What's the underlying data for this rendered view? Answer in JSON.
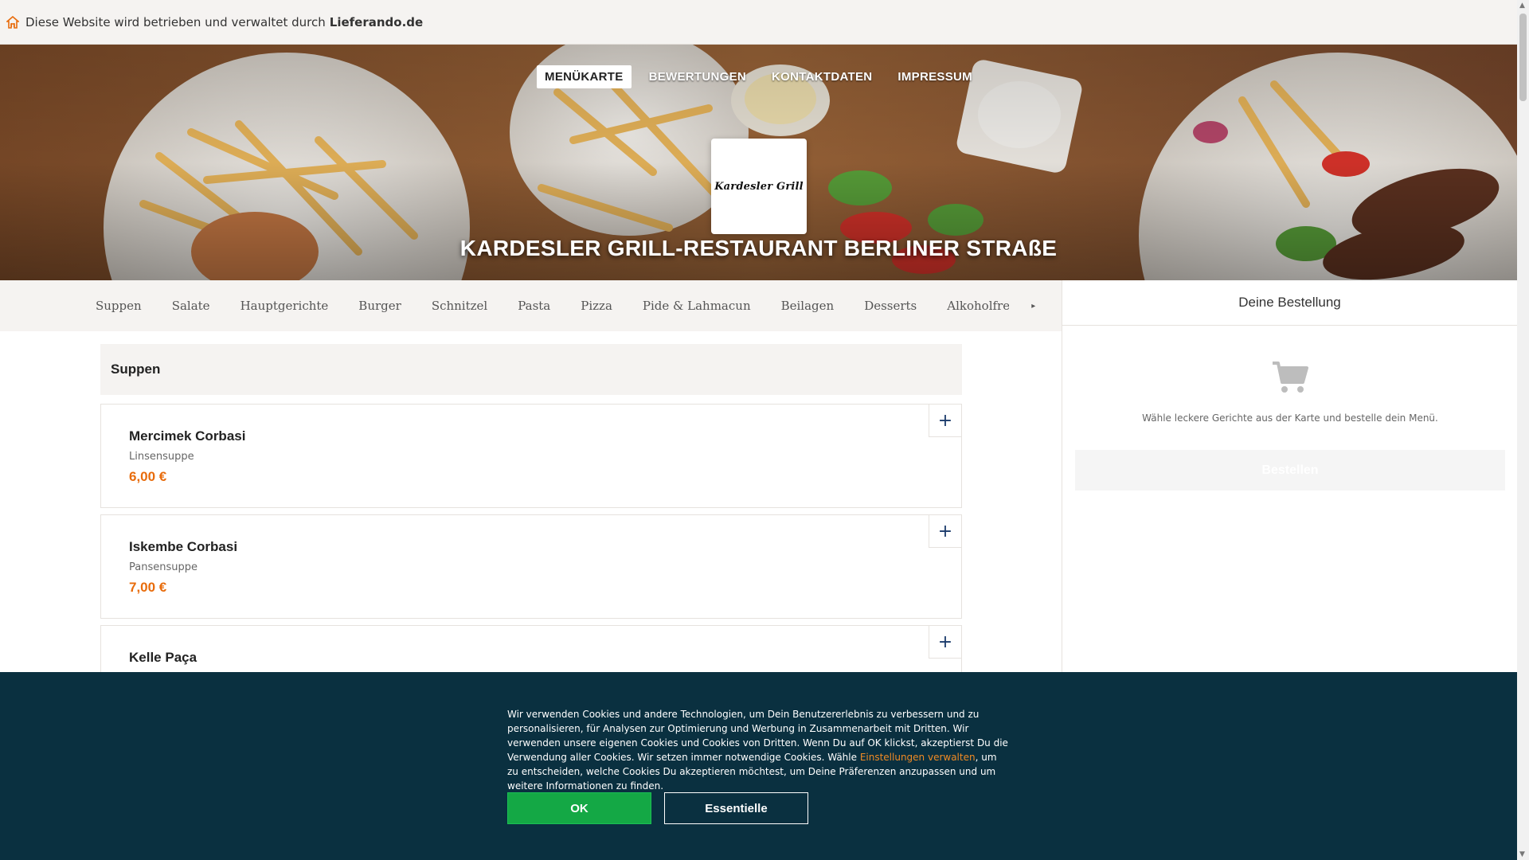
{
  "notice": {
    "text": "Diese Website wird betrieben und verwaltet durch",
    "brand": "Lieferando.de",
    "icon": "house-icon",
    "icon_color": "#e86c0c"
  },
  "top_nav": {
    "items": [
      "MENÜKARTE",
      "BEWERTUNGEN",
      "KONTAKTDATEN",
      "IMPRESSUM"
    ],
    "active_index": 0
  },
  "logo": {
    "text": "Kardesler Grill"
  },
  "restaurant": {
    "title": "KARDESLER GRILL-RESTAURANT BERLINER STRAßE"
  },
  "categories": {
    "items": [
      "Suppen",
      "Salate",
      "Hauptgerichte",
      "Burger",
      "Schnitzel",
      "Pasta",
      "Pizza",
      "Pide & Lahmacun",
      "Beilagen",
      "Desserts",
      "Alkoholfreie"
    ],
    "more_icon": "chevron-right-icon"
  },
  "section": {
    "title": "Suppen"
  },
  "menu_items": [
    {
      "name": "Mercimek Corbasi",
      "description": "Linsensuppe",
      "price": "6,00 €"
    },
    {
      "name": "Iskembe Corbasi",
      "description": "Pansensuppe",
      "price": "7,00 €"
    },
    {
      "name": "Kelle Paça",
      "description": "",
      "price": ""
    }
  ],
  "add_label": "+",
  "cart": {
    "title": "Deine Bestellung",
    "icon": "shopping-cart-icon",
    "empty_text": "Wähle leckere Gerichte aus der Karte und bestelle dein Menü.",
    "order_button": "Bestellen"
  },
  "cookie": {
    "text_before": "Wir verwenden Cookies und andere Technologien, um Dein Benutzererlebnis zu verbessern und zu personalisieren, für Analysen zur Optimierung und Werbung in Zusammenarbeit mit Dritten. Wir verwenden unsere eigenen Cookies und Cookies von Dritten. Wenn Du auf OK klickst, akzeptierst Du die Verwendung aller Cookies. Wir setzen immer notwendige Cookies. Wähle ",
    "link": "Einstellungen verwalten",
    "text_after": ", um zu entscheiden, welche Cookies Du akzeptieren möchtest, um Deine Präferenzen anzupassen und um weitere Informationen zu finden.",
    "ok_button": "OK",
    "essential_button": "Essentielle",
    "accent_color": "#14a845",
    "background_color": "#0a3040"
  },
  "colors": {
    "price": "#e86c0c",
    "section_bg": "#f5f3f1"
  }
}
